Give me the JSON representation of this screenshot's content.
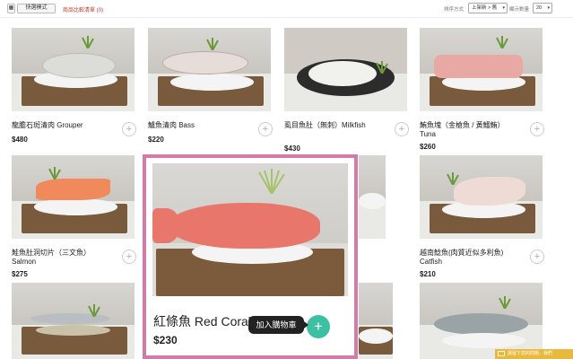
{
  "toolbar": {
    "grid_icon": "grid-icon",
    "quick_view_label": "快選模式",
    "compare_link": "商品比較清單 (0)",
    "sort_label": "排序方式",
    "sort_value": "上架新 > 舊",
    "perpage_label": "顯示數量",
    "perpage_value": "20"
  },
  "products": [
    {
      "name": "龍膽石斑清肉 Grouper",
      "price": "$480"
    },
    {
      "name": "鱸魚清肉 Bass",
      "price": "$220"
    },
    {
      "name": "虱目魚肚（無刺）Milkfish",
      "price": "$430"
    },
    {
      "name": "鮪魚塊（金槍魚 / 黃鰭鮪）Tuna",
      "price": "$260"
    },
    {
      "name": "鮭魚肚洞切片（三文魚）Salmon",
      "price": "$275"
    },
    {
      "name": "越南鯰魚(肉質近似多利魚) Catfish",
      "price": "$210"
    }
  ],
  "focused_product": {
    "name": "紅條魚 Red Coral Trout",
    "price": "$230",
    "add_label": "+",
    "tooltip": "加入購物車"
  },
  "add_icon": "+",
  "chat_bar": {
    "label": "請留下您的問題，我們",
    "icon": "mail-icon"
  },
  "colors": {
    "highlight_border": "#d67ba9",
    "add_button": "#3dbfa2",
    "chat_bar": "#e8b93a",
    "compare_link": "#c0392b"
  }
}
